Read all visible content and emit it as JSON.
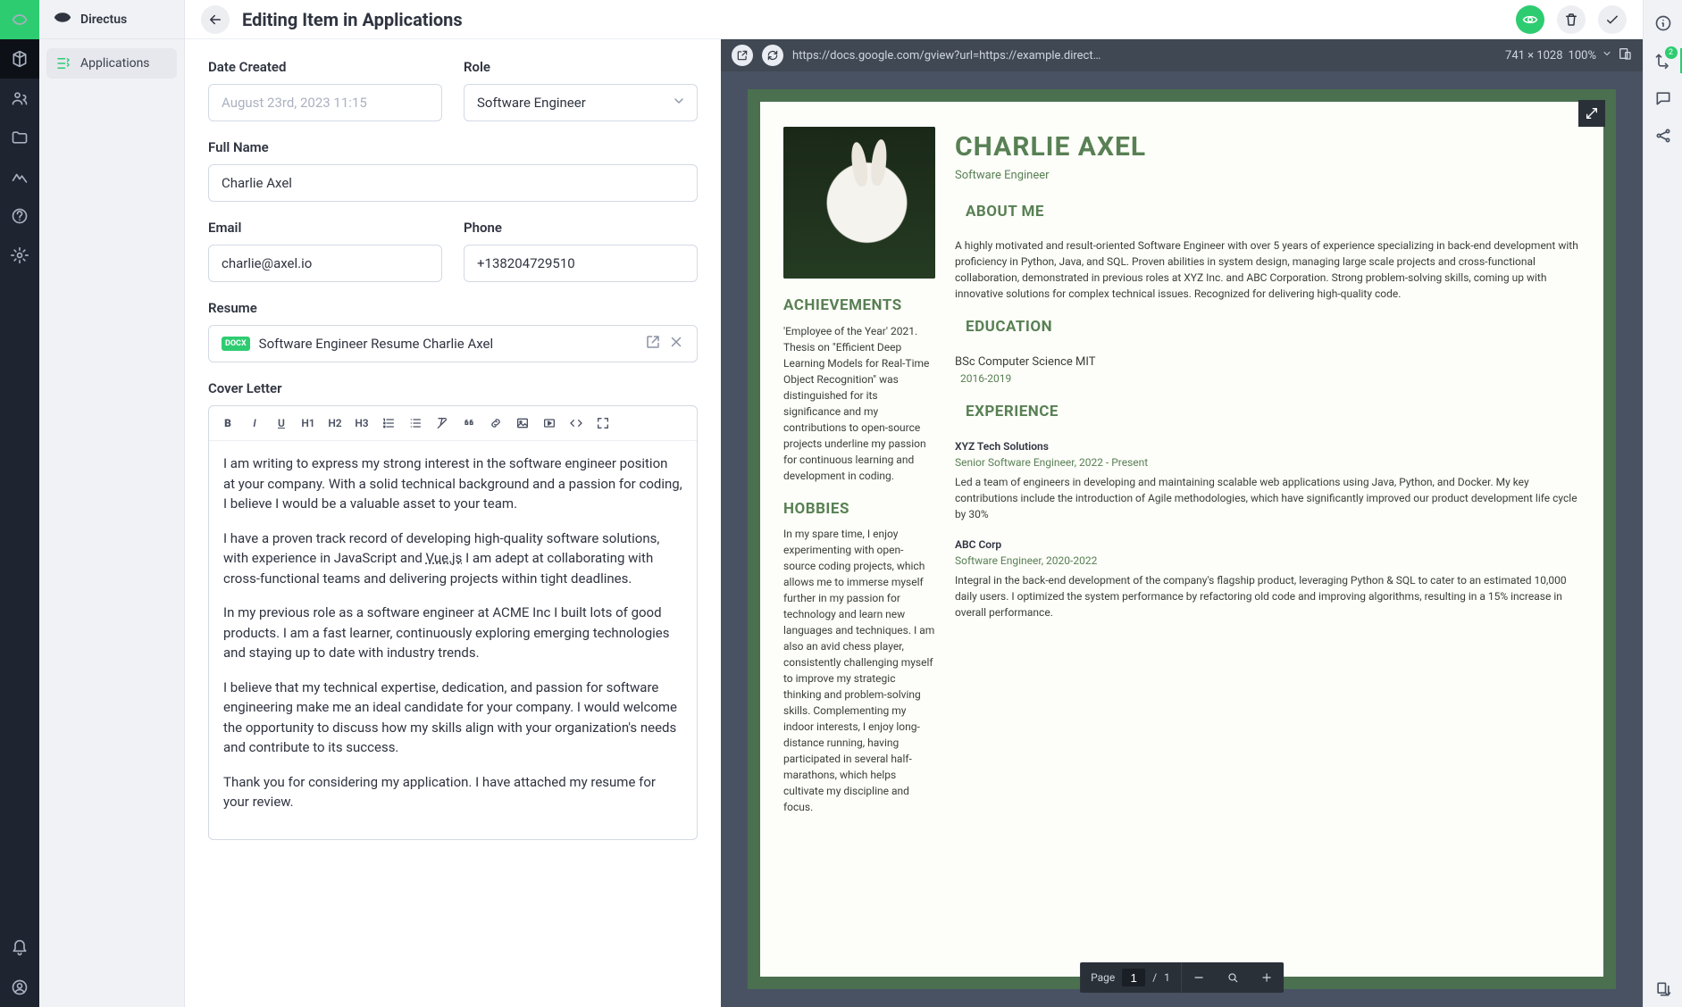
{
  "module": {
    "title": "Directus"
  },
  "sidebar": {
    "items": [
      {
        "label": "Applications"
      }
    ]
  },
  "header": {
    "title": "Editing Item in Applications"
  },
  "form": {
    "date_created": {
      "label": "Date Created",
      "value": "August 23rd, 2023 11:15"
    },
    "role": {
      "label": "Role",
      "value": "Software Engineer"
    },
    "full_name": {
      "label": "Full Name",
      "value": "Charlie Axel"
    },
    "email": {
      "label": "Email",
      "value": "charlie@axel.io"
    },
    "phone": {
      "label": "Phone",
      "value": "+138204729510"
    },
    "resume": {
      "label": "Resume",
      "badge": "DOCX",
      "filename": "Software Engineer Resume Charlie Axel"
    },
    "cover_letter": {
      "label": "Cover Letter",
      "p1": "I am writing to express my strong interest in the software engineer position at your company. With a solid technical background and a passion for coding, I believe I would be a valuable asset to your team.",
      "p2a": "I have a proven track record of developing high-quality software solutions, with experience in JavaScript and ",
      "p2_link": "Vue.js",
      "p2b": " I am adept at collaborating with cross-functional teams and delivering projects within tight deadlines.",
      "p3": "In my previous role as a software engineer at ACME Inc I built lots of good products. I am a fast learner, continuously exploring emerging technologies and staying up to date with industry trends.",
      "p4": "I believe that my technical expertise, dedication, and passion for software engineering make me an ideal candidate for your company. I would welcome the opportunity to discuss how my skills align with your organization's needs and contribute to its success.",
      "p5": "Thank you for considering my application. I have attached my resume for your review."
    }
  },
  "preview": {
    "url": "https://docs.google.com/gview?url=https://example.direct…",
    "dims": "741 × 1028",
    "zoom": "100%",
    "page_label": "Page",
    "page_cur": "1",
    "page_sep": "/",
    "page_total": "1"
  },
  "doc": {
    "name": "CHARLIE AXEL",
    "role": "Software Engineer",
    "about_h": "ABOUT ME",
    "about": "A highly motivated and result-oriented Software Engineer with over 5 years of experience specializing in back-end development with proficiency in Python, Java, and SQL. Proven abilities in system design, managing large scale projects and cross-functional collaboration, demonstrated in previous roles at XYZ Inc. and ABC Corporation. Strong problem-solving skills, coming up with innovative solutions for complex technical issues. Recognized for delivering high-quality code.",
    "ach_h": "ACHIEVEMENTS",
    "ach": "'Employee of the Year' 2021. Thesis on \"Efficient Deep Learning Models for Real-Time Object Recognition\" was distinguished for its significance and my contributions to open-source projects underline my passion for continuous learning and development in coding.",
    "hob_h": "HOBBIES",
    "hob": "In my spare time, I enjoy experimenting with open-source coding projects, which allows me to immerse myself further in my passion for technology and learn new languages and techniques. I am also an avid chess player, consistently challenging myself to improve my strategic thinking and problem-solving skills. Complementing my indoor interests, I enjoy long-distance running, having participated in several half-marathons, which helps cultivate my discipline and focus.",
    "edu_h": "EDUCATION",
    "edu_deg": "BSc Computer Science MIT",
    "edu_yr": "2016-2019",
    "exp_h": "EXPERIENCE",
    "exp1_co": "XYZ Tech Solutions",
    "exp1_role": "Senior Software Engineer, 2022 - Present",
    "exp1_desc": "Led a team of engineers in developing and maintaining scalable web applications using Java, Python, and Docker. My key contributions include the introduction of Agile methodologies, which have significantly improved our product development life cycle by 30%",
    "exp2_co": "ABC Corp",
    "exp2_role": "Software Engineer, 2020-2022",
    "exp2_desc": "Integral in the back-end development of the company's flagship product, leveraging Python & SQL to cater to an estimated 10,000 daily users. I optimized the system performance by refactoring old code and improving algorithms, resulting in a 15% increase in overall performance."
  },
  "dock": {
    "badge": "2"
  }
}
